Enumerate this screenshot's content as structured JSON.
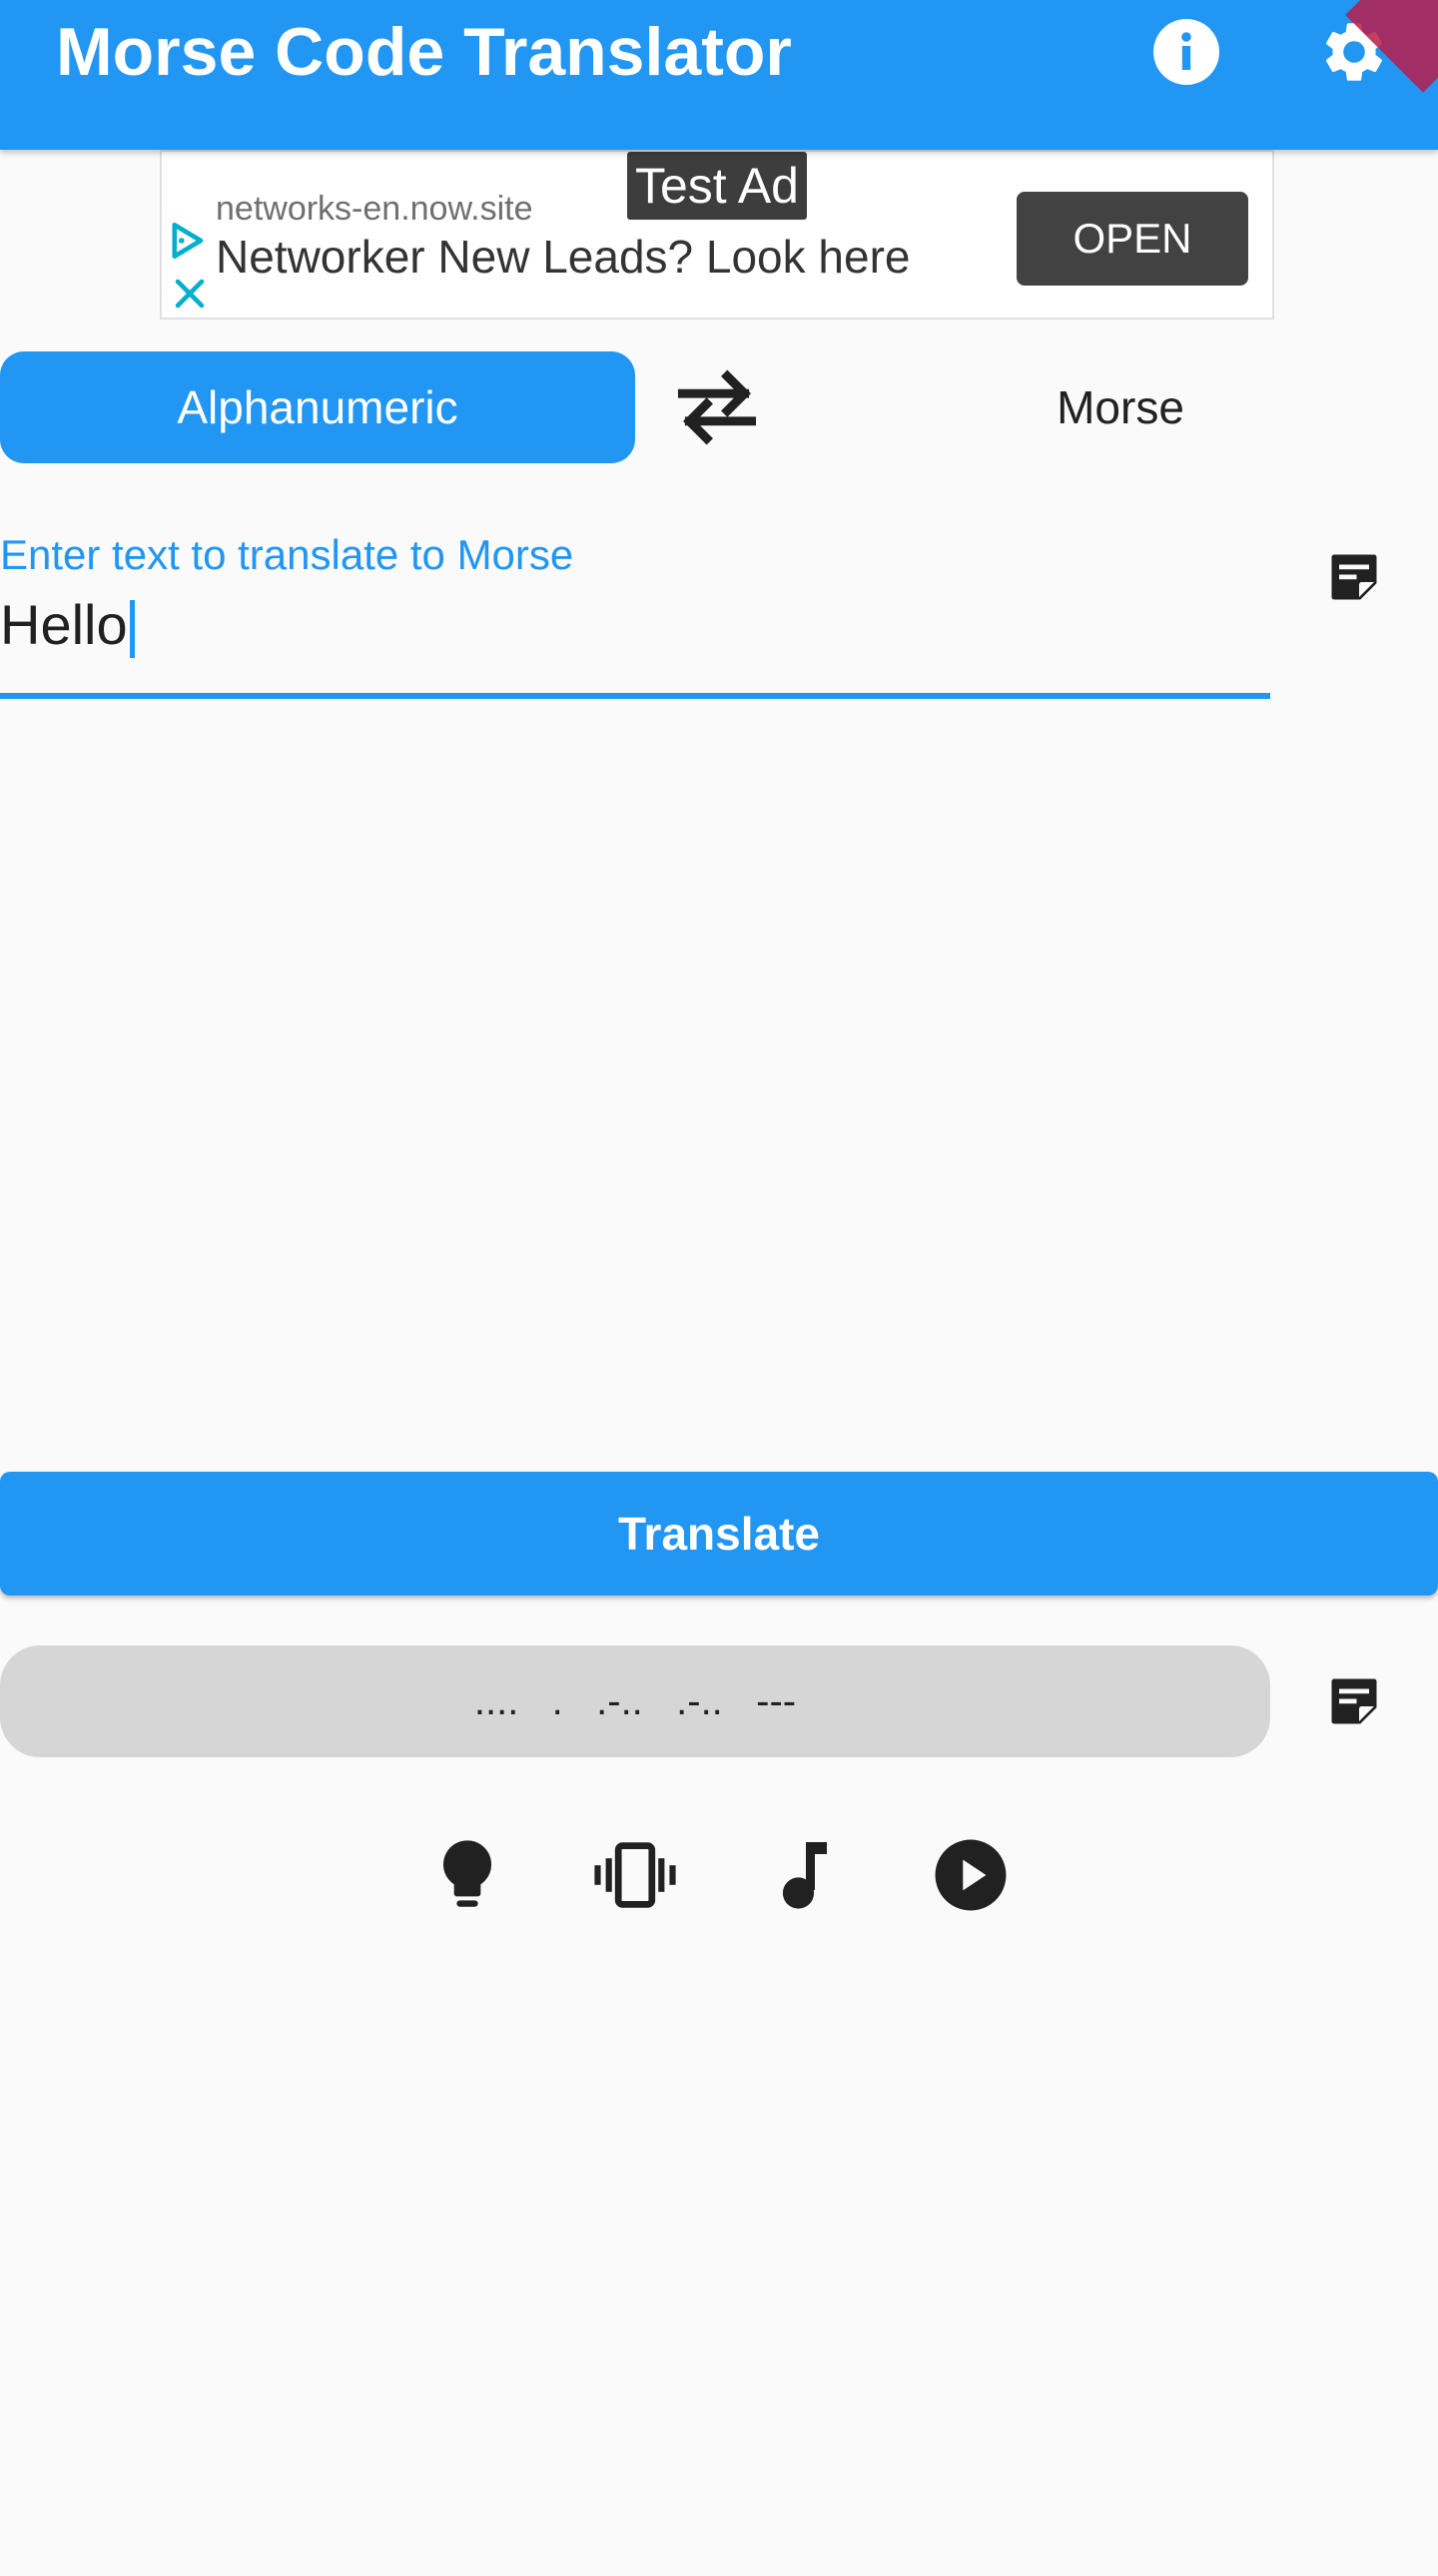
{
  "app_bar": {
    "title": "Morse Code Translator",
    "info_icon": "info-icon",
    "settings_icon": "gear-icon",
    "color": "#2196f3"
  },
  "ad": {
    "test_label": "Test Ad",
    "domain": "networks-en.now.site",
    "headline": "Networker New Leads? Look here",
    "open_label": "OPEN",
    "ad_choices_icon": "play-triangle-icon",
    "close_icon": "close-icon"
  },
  "mode_toggle": {
    "alphanumeric_label": "Alphanumeric",
    "morse_label": "Morse",
    "swap_icon": "swap-arrows-icon",
    "selected": "Alphanumeric"
  },
  "input": {
    "label": "Enter text to translate to Morse",
    "value": "Hello",
    "note_icon": "note-icon"
  },
  "translate_button": {
    "label": "Translate"
  },
  "output": {
    "value": "....   .   .-..   .-..   ---",
    "note_icon": "note-icon"
  },
  "controls": {
    "icons": [
      "lightbulb-icon",
      "vibrate-icon",
      "music-note-icon",
      "play-circle-icon"
    ]
  }
}
